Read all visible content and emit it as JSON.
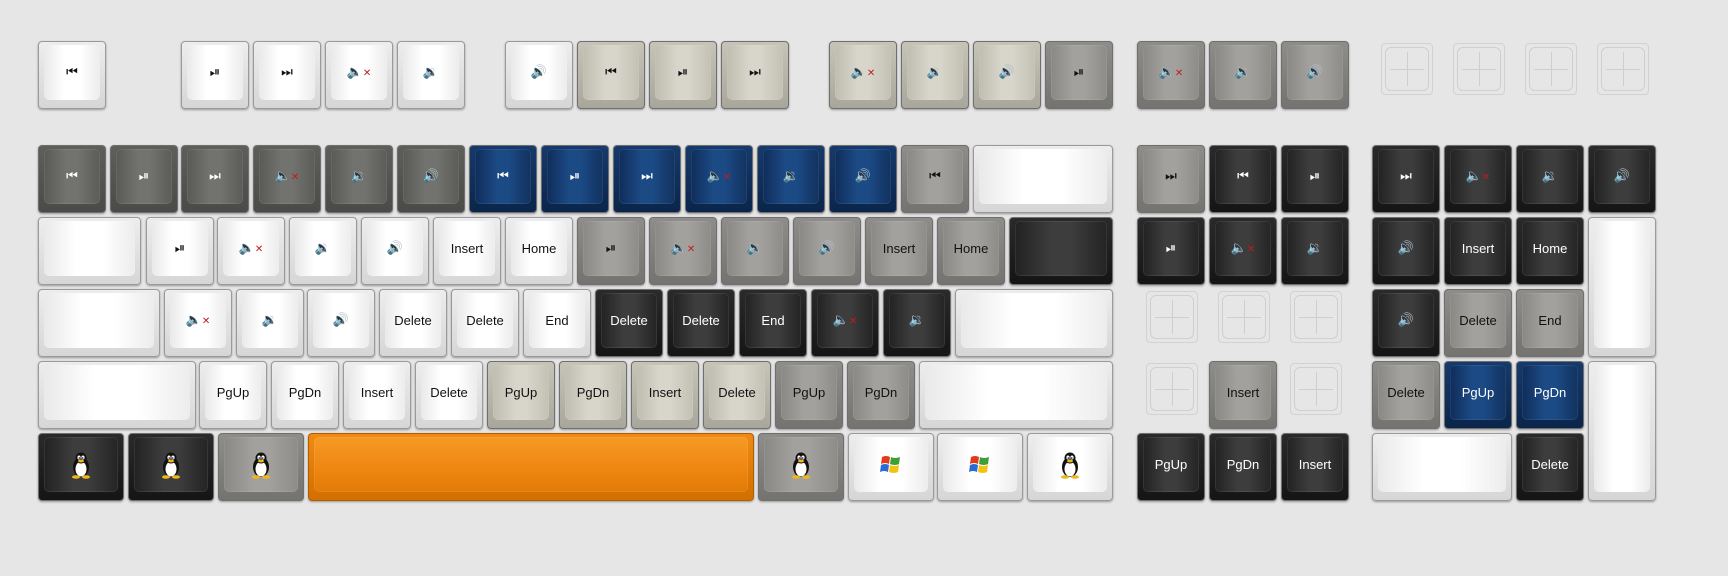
{
  "palette": {
    "white": {
      "bg": "linear-gradient(180deg,#ededed,#d6d6d6)",
      "cap": "linear-gradient(90deg,#e9e9e9 0%,#ffffff 35%,#ffffff 65%,#ececec 100%)",
      "fg": "#111111"
    },
    "beige": {
      "bg": "linear-gradient(180deg,#c6c3b7,#a9a69b)",
      "cap": "linear-gradient(90deg,#bfbcb0 0%,#d8d5ca 40%,#d8d5ca 60%,#c3c0b4 100%)",
      "fg": "#111111"
    },
    "gray": {
      "bg": "linear-gradient(180deg,#8f8d89,#757370)",
      "cap": "linear-gradient(90deg,#8a8885 0%,#a3a19d 40%,#a3a19d 60%,#8e8c88 100%)",
      "fg": "#111111"
    },
    "dgray": {
      "bg": "linear-gradient(180deg,#5e5f5b,#4a4b48)",
      "cap": "linear-gradient(90deg,#595a56 0%,#72736f 40%,#72736f 60%,#5b5c58 100%)",
      "fg": "#ffffff"
    },
    "black": {
      "bg": "linear-gradient(180deg,#2a2a2a,#151515)",
      "cap": "linear-gradient(90deg,#222222 0%,#3d3d3d 40%,#3d3d3d 60%,#242424 100%)",
      "fg": "#ffffff"
    },
    "blue": {
      "bg": "linear-gradient(180deg,#153a6c,#0b254a)",
      "cap": "linear-gradient(90deg,#0f2d5a 0%,#1c4a85 40%,#1c4a85 60%,#12325f 100%)",
      "fg": "#ffffff"
    },
    "orange": {
      "bg": "linear-gradient(180deg,#f08a12,#d36f00)",
      "cap": "linear-gradient(180deg,#f59a24 0%,#ee8611 60%,#e27b07 100%)",
      "fg": "#111111"
    }
  },
  "keys": [
    {
      "id": "k1",
      "row": 0,
      "c": "white",
      "i": "prev-icon"
    },
    {
      "id": "k2",
      "row": 0,
      "c": "white",
      "i": "play-pause-icon"
    },
    {
      "id": "k3",
      "row": 0,
      "c": "white",
      "i": "next-icon"
    },
    {
      "id": "k4",
      "row": 0,
      "c": "white",
      "i": "mute-icon"
    },
    {
      "id": "k5",
      "row": 0,
      "c": "white",
      "i": "volume-down-icon"
    },
    {
      "id": "k6",
      "row": 0,
      "c": "white",
      "i": "volume-up-icon"
    },
    {
      "id": "k7",
      "row": 0,
      "c": "beige",
      "i": "prev-icon"
    },
    {
      "id": "k8",
      "row": 0,
      "c": "beige",
      "i": "play-pause-icon"
    },
    {
      "id": "k9",
      "row": 0,
      "c": "beige",
      "i": "next-icon"
    },
    {
      "id": "k10",
      "row": 0,
      "c": "beige",
      "i": "mute-icon"
    },
    {
      "id": "k11",
      "row": 0,
      "c": "beige",
      "i": "volume-down-icon"
    },
    {
      "id": "k12",
      "row": 0,
      "c": "beige",
      "i": "volume-up-icon"
    },
    {
      "id": "k13",
      "row": 0,
      "c": "gray",
      "i": "play-pause-icon"
    },
    {
      "id": "k14",
      "row": 0,
      "c": "gray",
      "i": "mute-icon"
    },
    {
      "id": "k15",
      "row": 0,
      "c": "gray",
      "i": "volume-down-icon"
    },
    {
      "id": "k16",
      "row": 0,
      "c": "gray",
      "i": "volume-up-icon"
    },
    {
      "id": "k17",
      "row": 0,
      "c": "empty"
    },
    {
      "id": "k18",
      "row": 0,
      "c": "empty"
    },
    {
      "id": "k19",
      "row": 0,
      "c": "empty"
    },
    {
      "id": "k20",
      "row": 0,
      "c": "empty"
    },
    {
      "id": "k21",
      "row": 1,
      "c": "dgray",
      "i": "prev-icon"
    },
    {
      "id": "k22",
      "row": 1,
      "c": "dgray",
      "i": "play-pause-icon"
    },
    {
      "id": "k23",
      "row": 1,
      "c": "dgray",
      "i": "next-icon"
    },
    {
      "id": "k24",
      "row": 1,
      "c": "dgray",
      "i": "mute-icon"
    },
    {
      "id": "k25",
      "row": 1,
      "c": "dgray",
      "i": "volume-down-icon"
    },
    {
      "id": "k26",
      "row": 1,
      "c": "dgray",
      "i": "volume-up-icon"
    },
    {
      "id": "k27",
      "row": 1,
      "c": "blue",
      "i": "prev-icon"
    },
    {
      "id": "k28",
      "row": 1,
      "c": "blue",
      "i": "play-pause-icon"
    },
    {
      "id": "k29",
      "row": 1,
      "c": "blue",
      "i": "next-icon"
    },
    {
      "id": "k30",
      "row": 1,
      "c": "blue",
      "i": "mute-icon"
    },
    {
      "id": "k31",
      "row": 1,
      "c": "blue",
      "i": "volume-down-icon"
    },
    {
      "id": "k32",
      "row": 1,
      "c": "blue",
      "i": "volume-up-icon"
    },
    {
      "id": "k33",
      "row": 1,
      "c": "gray",
      "i": "prev-icon"
    },
    {
      "id": "k34",
      "row": 1,
      "c": "white"
    },
    {
      "id": "k35",
      "row": 1,
      "c": "gray",
      "i": "next-icon"
    },
    {
      "id": "k36",
      "row": 1,
      "c": "black",
      "i": "prev-icon"
    },
    {
      "id": "k37",
      "row": 1,
      "c": "black",
      "i": "play-pause-icon"
    },
    {
      "id": "k38",
      "row": 1,
      "c": "black",
      "i": "next-icon"
    },
    {
      "id": "k39",
      "row": 1,
      "c": "black",
      "i": "mute-icon"
    },
    {
      "id": "k40",
      "row": 1,
      "c": "black",
      "i": "volume-down-icon"
    },
    {
      "id": "k41",
      "row": 1,
      "c": "black",
      "i": "volume-up-icon"
    },
    {
      "id": "k42",
      "row": 2,
      "c": "white"
    },
    {
      "id": "k43",
      "row": 2,
      "c": "white",
      "i": "play-pause-icon"
    },
    {
      "id": "k44",
      "row": 2,
      "c": "white",
      "i": "mute-icon"
    },
    {
      "id": "k45",
      "row": 2,
      "c": "white",
      "i": "volume-down-icon"
    },
    {
      "id": "k46",
      "row": 2,
      "c": "white",
      "i": "volume-up-icon"
    },
    {
      "id": "k47",
      "row": 2,
      "c": "white",
      "t": "Insert"
    },
    {
      "id": "k48",
      "row": 2,
      "c": "white",
      "t": "Home"
    },
    {
      "id": "k49",
      "row": 2,
      "c": "gray",
      "i": "play-pause-icon"
    },
    {
      "id": "k50",
      "row": 2,
      "c": "gray",
      "i": "mute-icon"
    },
    {
      "id": "k51",
      "row": 2,
      "c": "gray",
      "i": "volume-down-icon"
    },
    {
      "id": "k52",
      "row": 2,
      "c": "gray",
      "i": "volume-up-icon"
    },
    {
      "id": "k53",
      "row": 2,
      "c": "gray",
      "t": "Insert"
    },
    {
      "id": "k54",
      "row": 2,
      "c": "gray",
      "t": "Home"
    },
    {
      "id": "k55",
      "row": 2,
      "c": "black"
    },
    {
      "id": "k56",
      "row": 2,
      "c": "black",
      "i": "play-pause-icon"
    },
    {
      "id": "k57",
      "row": 2,
      "c": "black",
      "i": "mute-icon"
    },
    {
      "id": "k58",
      "row": 2,
      "c": "black",
      "i": "volume-down-icon"
    },
    {
      "id": "k59",
      "row": 2,
      "c": "black",
      "i": "volume-up-icon"
    },
    {
      "id": "k60",
      "row": 2,
      "c": "black",
      "t": "Insert"
    },
    {
      "id": "k61",
      "row": 2,
      "c": "black",
      "t": "Home"
    },
    {
      "id": "k62",
      "row": 2,
      "c": "white"
    },
    {
      "id": "k63",
      "row": 3,
      "c": "white"
    },
    {
      "id": "k64",
      "row": 3,
      "c": "white",
      "i": "mute-icon"
    },
    {
      "id": "k65",
      "row": 3,
      "c": "white",
      "i": "volume-down-icon"
    },
    {
      "id": "k66",
      "row": 3,
      "c": "white",
      "i": "volume-up-icon"
    },
    {
      "id": "k67",
      "row": 3,
      "c": "white",
      "t": "Delete"
    },
    {
      "id": "k68",
      "row": 3,
      "c": "white",
      "t": "Delete"
    },
    {
      "id": "k69",
      "row": 3,
      "c": "white",
      "t": "End"
    },
    {
      "id": "k70",
      "row": 3,
      "c": "black",
      "t": "Delete"
    },
    {
      "id": "k71",
      "row": 3,
      "c": "black",
      "t": "Delete"
    },
    {
      "id": "k72",
      "row": 3,
      "c": "black",
      "t": "End"
    },
    {
      "id": "k73",
      "row": 3,
      "c": "black",
      "i": "mute-icon"
    },
    {
      "id": "k74",
      "row": 3,
      "c": "black",
      "i": "volume-down-icon"
    },
    {
      "id": "k75",
      "row": 3,
      "c": "white"
    },
    {
      "id": "k76",
      "row": 3,
      "c": "empty"
    },
    {
      "id": "k77",
      "row": 3,
      "c": "empty"
    },
    {
      "id": "k78",
      "row": 3,
      "c": "empty"
    },
    {
      "id": "k79",
      "row": 3,
      "c": "black",
      "i": "volume-up-icon"
    },
    {
      "id": "k80",
      "row": 3,
      "c": "gray",
      "t": "Delete"
    },
    {
      "id": "k81",
      "row": 3,
      "c": "gray",
      "t": "End"
    },
    {
      "id": "k82",
      "row": 4,
      "c": "white"
    },
    {
      "id": "k83",
      "row": 4,
      "c": "white",
      "t": "PgUp"
    },
    {
      "id": "k84",
      "row": 4,
      "c": "white",
      "t": "PgDn"
    },
    {
      "id": "k85",
      "row": 4,
      "c": "white",
      "t": "Insert"
    },
    {
      "id": "k86",
      "row": 4,
      "c": "white",
      "t": "Delete"
    },
    {
      "id": "k87",
      "row": 4,
      "c": "beige",
      "t": "PgUp"
    },
    {
      "id": "k88",
      "row": 4,
      "c": "beige",
      "t": "PgDn"
    },
    {
      "id": "k89",
      "row": 4,
      "c": "beige",
      "t": "Insert"
    },
    {
      "id": "k90",
      "row": 4,
      "c": "beige",
      "t": "Delete"
    },
    {
      "id": "k91",
      "row": 4,
      "c": "gray",
      "t": "PgUp"
    },
    {
      "id": "k92",
      "row": 4,
      "c": "gray",
      "t": "PgDn"
    },
    {
      "id": "k93",
      "row": 4,
      "c": "white"
    },
    {
      "id": "k94",
      "row": 4,
      "c": "empty"
    },
    {
      "id": "k95",
      "row": 4,
      "c": "gray",
      "t": "Insert"
    },
    {
      "id": "k96",
      "row": 4,
      "c": "empty"
    },
    {
      "id": "k97",
      "row": 4,
      "c": "gray",
      "t": "Delete"
    },
    {
      "id": "k98",
      "row": 4,
      "c": "blue",
      "t": "PgUp"
    },
    {
      "id": "k99",
      "row": 4,
      "c": "blue",
      "t": "PgDn"
    },
    {
      "id": "k100",
      "row": 4,
      "c": "white"
    },
    {
      "id": "k101",
      "row": 5,
      "c": "black",
      "i": "tux-icon"
    },
    {
      "id": "k102",
      "row": 5,
      "c": "black",
      "i": "tux-icon"
    },
    {
      "id": "k103",
      "row": 5,
      "c": "gray",
      "i": "tux-icon"
    },
    {
      "id": "k104",
      "row": 5,
      "c": "orange"
    },
    {
      "id": "k105",
      "row": 5,
      "c": "gray",
      "i": "tux-icon"
    },
    {
      "id": "k106",
      "row": 5,
      "c": "white",
      "i": "windows-icon"
    },
    {
      "id": "k107",
      "row": 5,
      "c": "white",
      "i": "windows-icon"
    },
    {
      "id": "k108",
      "row": 5,
      "c": "white",
      "i": "tux-icon"
    },
    {
      "id": "k109",
      "row": 5,
      "c": "black",
      "t": "PgUp"
    },
    {
      "id": "k110",
      "row": 5,
      "c": "black",
      "t": "PgDn"
    },
    {
      "id": "k111",
      "row": 5,
      "c": "black",
      "t": "Insert"
    },
    {
      "id": "k112",
      "row": 5,
      "c": "white"
    },
    {
      "id": "k113",
      "row": 5,
      "c": "black",
      "t": "Delete"
    }
  ]
}
